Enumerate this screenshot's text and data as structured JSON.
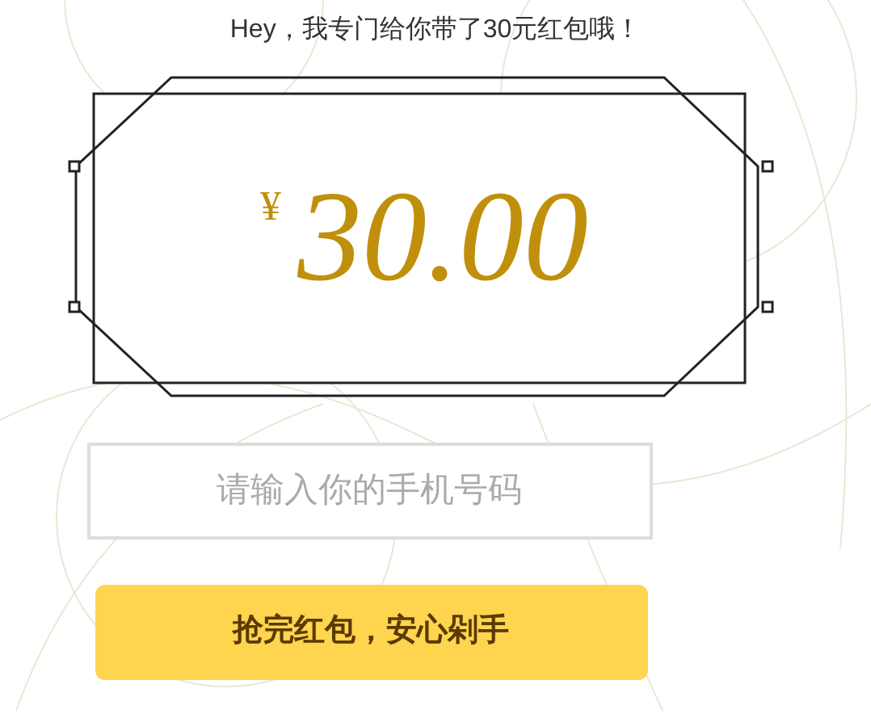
{
  "greeting": "Hey，我专门给你带了30元红包哦！",
  "coupon": {
    "currency": "¥",
    "amount": "30.00"
  },
  "phone_field": {
    "placeholder": "请输入你的手机号码"
  },
  "submit_button": {
    "label": "抢完红包，安心剁手"
  }
}
